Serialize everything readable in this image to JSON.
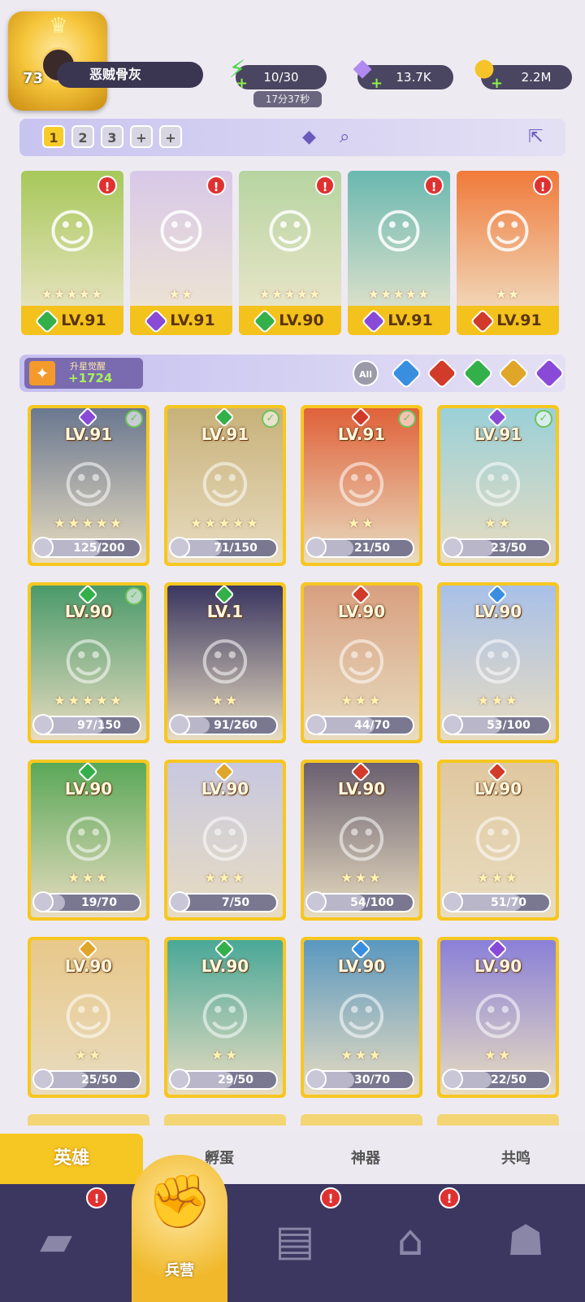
{
  "player": {
    "level": "73",
    "name": "恶贼骨灰"
  },
  "resources": {
    "energy": {
      "value": "10/30",
      "timer": "17分37秒",
      "icon": "lightning-icon"
    },
    "gems": {
      "value": "13.7K",
      "icon": "diamond-icon"
    },
    "coins": {
      "value": "2.2M",
      "icon": "coin-icon"
    }
  },
  "team": {
    "slots": [
      "1",
      "2",
      "3",
      "+",
      "+"
    ],
    "active_slot": "1",
    "lineup": [
      {
        "level": "LV.91",
        "stars": "★★★★★",
        "element": "#34b04a",
        "bg": "#a7c85a",
        "alert": "!"
      },
      {
        "level": "LV.91",
        "stars": "★★",
        "element": "#8a4ad8",
        "bg": "#d8c8e8",
        "alert": "!"
      },
      {
        "level": "LV.90",
        "stars": "★★★★★",
        "element": "#34b04a",
        "bg": "#b6d4a0",
        "alert": "!"
      },
      {
        "level": "LV.91",
        "stars": "★★★★★",
        "element": "#8a4ad8",
        "bg": "#6ab8b0",
        "alert": "!"
      },
      {
        "level": "LV.91",
        "stars": "★★",
        "element": "#d23a2a",
        "bg": "#f07a3a",
        "alert": "!"
      }
    ]
  },
  "filter": {
    "shards_label": "升星觉醒",
    "shards_value": "+1724",
    "all_label": "All",
    "elements": [
      "#3a8ee0",
      "#d23a2a",
      "#34b04a",
      "#e0a62a",
      "#8a4ad8"
    ]
  },
  "heroes": [
    {
      "level": "LV.91",
      "gem": "#8a4ad8",
      "checked": true,
      "stars": "★★★★★",
      "progress": "125/200",
      "ratio": 0.62,
      "bg": "#6a7890"
    },
    {
      "level": "LV.91",
      "gem": "#34b04a",
      "checked": true,
      "stars": "★★★★★",
      "progress": "71/150",
      "ratio": 0.47,
      "bg": "#c8b27a"
    },
    {
      "level": "LV.91",
      "gem": "#d23a2a",
      "checked": true,
      "stars": "★★",
      "progress": "21/50",
      "ratio": 0.42,
      "bg": "#e0623a"
    },
    {
      "level": "LV.91",
      "gem": "#8a4ad8",
      "checked": true,
      "stars": "★★",
      "progress": "23/50",
      "ratio": 0.46,
      "bg": "#9ad0d8"
    },
    {
      "level": "LV.90",
      "gem": "#34b04a",
      "checked": true,
      "stars": "★★★★★",
      "progress": "97/150",
      "ratio": 0.65,
      "bg": "#4a9a6a"
    },
    {
      "level": "LV.1",
      "gem": "#34b04a",
      "checked": false,
      "stars": "★★",
      "progress": "91/260",
      "ratio": 0.35,
      "bg": "#3a3660"
    },
    {
      "level": "LV.90",
      "gem": "#d23a2a",
      "checked": false,
      "stars": "★★★",
      "progress": "44/70",
      "ratio": 0.63,
      "bg": "#d8a080"
    },
    {
      "level": "LV.90",
      "gem": "#3a8ee0",
      "checked": false,
      "stars": "★★★",
      "progress": "53/100",
      "ratio": 0.53,
      "bg": "#a8c0e8"
    },
    {
      "level": "LV.90",
      "gem": "#34b04a",
      "checked": false,
      "stars": "★★★",
      "progress": "19/70",
      "ratio": 0.27,
      "bg": "#5aa858"
    },
    {
      "level": "LV.90",
      "gem": "#e0a62a",
      "checked": false,
      "stars": "★★★",
      "progress": "7/50",
      "ratio": 0.14,
      "bg": "#c8c8e0"
    },
    {
      "level": "LV.90",
      "gem": "#d23a2a",
      "checked": false,
      "stars": "★★★",
      "progress": "54/100",
      "ratio": 0.54,
      "bg": "#6a6070"
    },
    {
      "level": "LV.90",
      "gem": "#d23a2a",
      "checked": false,
      "stars": "★★★",
      "progress": "51/70",
      "ratio": 0.73,
      "bg": "#e0c8a0"
    },
    {
      "level": "LV.90",
      "gem": "#e0a62a",
      "checked": false,
      "stars": "★★",
      "progress": "25/50",
      "ratio": 0.5,
      "bg": "#e8c88a"
    },
    {
      "level": "LV.90",
      "gem": "#34b04a",
      "checked": false,
      "stars": "★★",
      "progress": "29/50",
      "ratio": 0.58,
      "bg": "#4aa898"
    },
    {
      "level": "LV.90",
      "gem": "#3a8ee0",
      "checked": false,
      "stars": "★★★",
      "progress": "30/70",
      "ratio": 0.43,
      "bg": "#5a98c0"
    },
    {
      "level": "LV.90",
      "gem": "#8a4ad8",
      "checked": false,
      "stars": "★★",
      "progress": "22/50",
      "ratio": 0.44,
      "bg": "#8a80d8"
    }
  ],
  "subtabs": [
    "英雄",
    "孵蛋",
    "神器",
    "共鸣"
  ],
  "nav": {
    "center_label": "兵营",
    "badge": "!"
  }
}
